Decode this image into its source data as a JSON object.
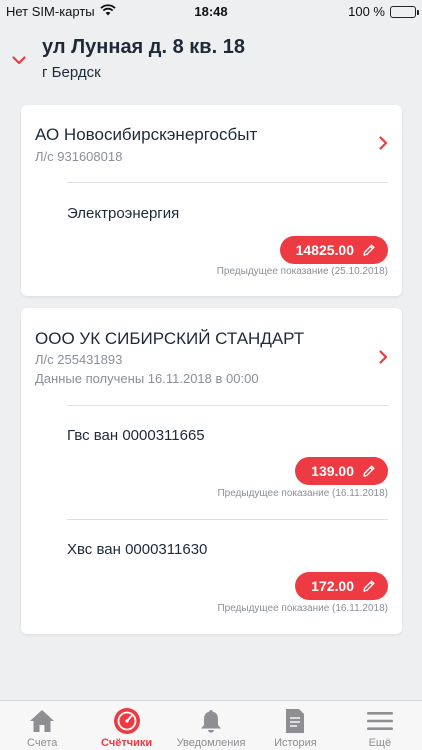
{
  "status_bar": {
    "carrier": "Нет SIM-карты",
    "time": "18:48",
    "battery": "100 %"
  },
  "header": {
    "address": "ул Лунная д. 8 кв. 18",
    "city": "г Бердск"
  },
  "providers": [
    {
      "name": "АО Новосибирскэнергосбыт",
      "account": "Л/с 931608018",
      "meters": [
        {
          "name": "Электроэнергия",
          "reading": "14825.00",
          "previous": "Предыдущее показание (25.10.2018)"
        }
      ]
    },
    {
      "name": "ООО УК СИБИРСКИЙ СТАНДАРТ",
      "account": "Л/с 255431893",
      "data_received": "Данные получены 16.11.2018 в 00:00",
      "meters": [
        {
          "name": "Гвс ван 0000311665",
          "reading": "139.00",
          "previous": "Предыдущее показание (16.11.2018)"
        },
        {
          "name": "Хвс ван 0000311630",
          "reading": "172.00",
          "previous": "Предыдущее показание (16.11.2018)"
        }
      ]
    }
  ],
  "tabs": [
    {
      "label": "Счета",
      "icon": "home-icon"
    },
    {
      "label": "Счётчики",
      "icon": "meter-icon",
      "active": true
    },
    {
      "label": "Уведомления",
      "icon": "bell-icon"
    },
    {
      "label": "История",
      "icon": "document-icon"
    },
    {
      "label": "Ещё",
      "icon": "menu-icon"
    }
  ],
  "colors": {
    "accent": "#ee3b43",
    "text": "#1e2a3a",
    "muted": "#8a8f98",
    "background": "#eeeff1"
  }
}
